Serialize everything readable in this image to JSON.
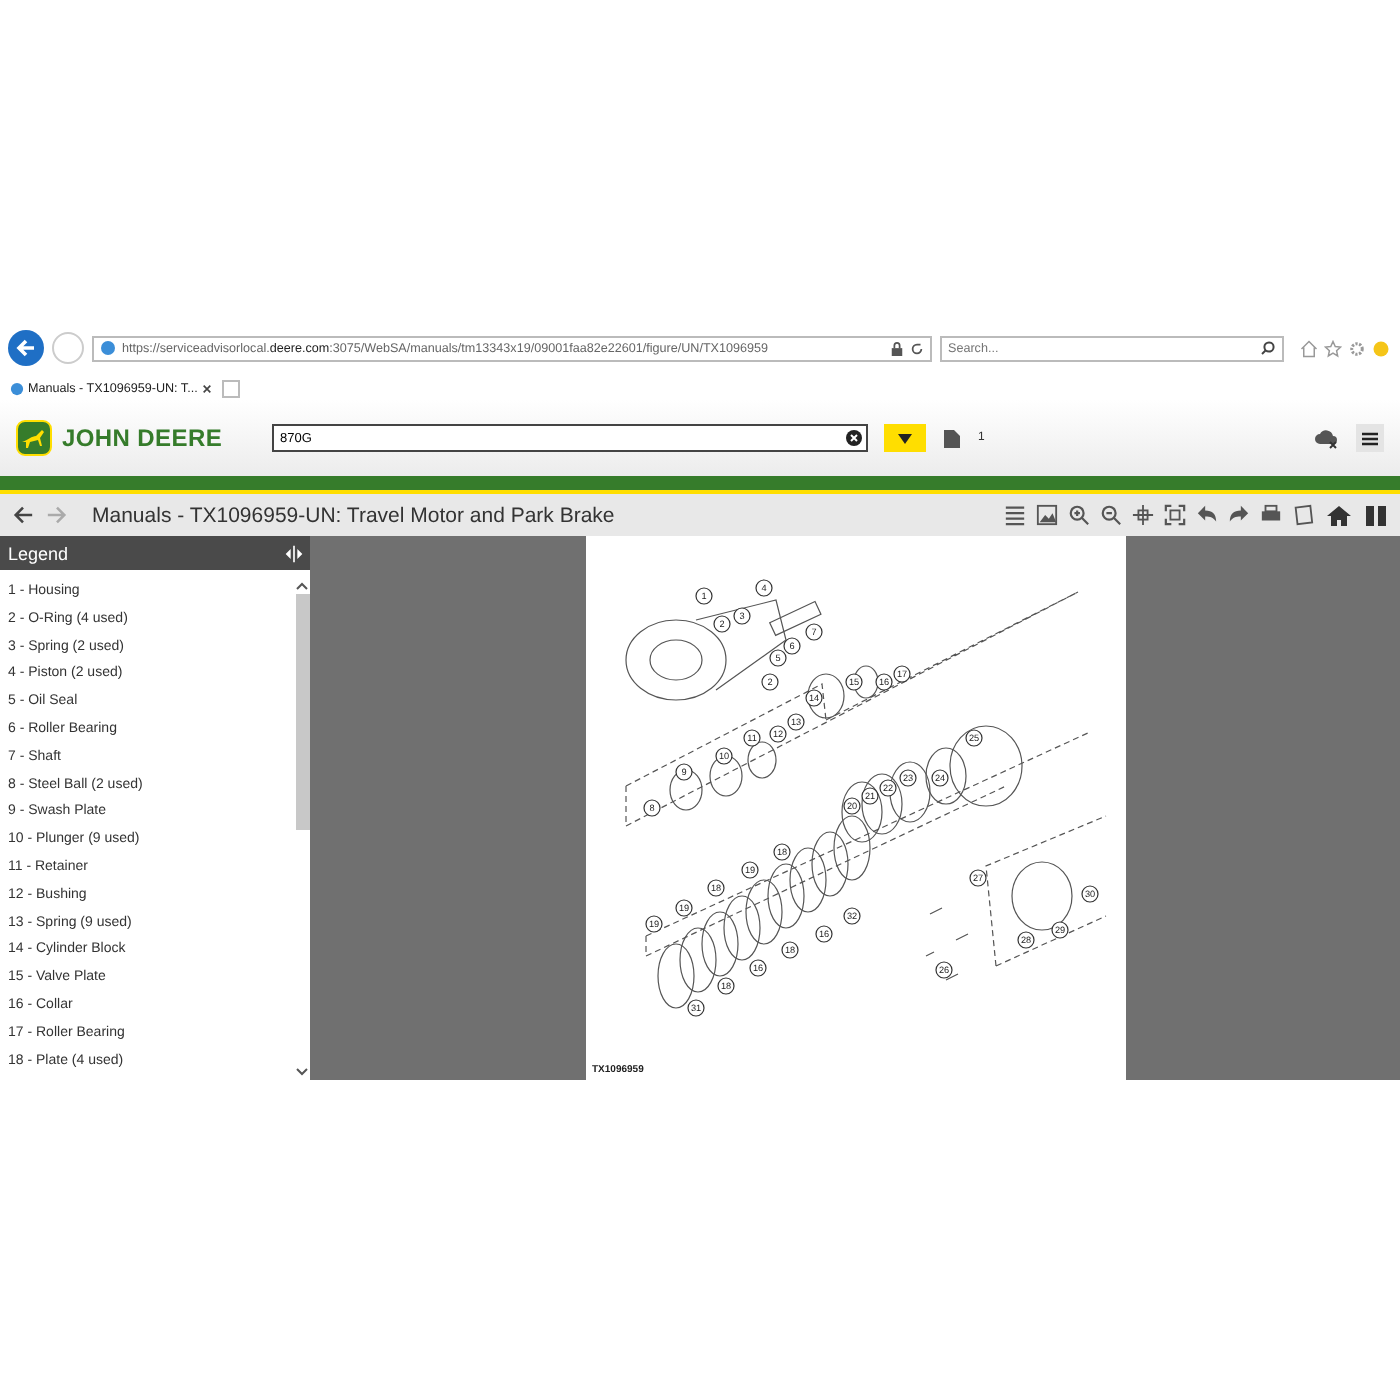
{
  "browser": {
    "address": "https://serviceadvisorlocal.**deere.com**:3075/WebSA/manuals/tm13343x19/09001faa82e22601/figure/UN/TX1096959",
    "search_placeholder": "Search...",
    "tab_title": "Manuals - TX1096959-UN: T..."
  },
  "header": {
    "brand": "JOHN DEERE",
    "search_value": "870G",
    "badge": "1"
  },
  "page_title": "Manuals - TX1096959-UN: Travel Motor and Park Brake",
  "legend": {
    "title": "Legend",
    "items": [
      "1 - Housing",
      "2 - O-Ring (4 used)",
      "3 - Spring (2 used)",
      "4 - Piston (2 used)",
      "5 - Oil Seal",
      "6 - Roller Bearing",
      "7 - Shaft",
      "8 - Steel Ball (2 used)",
      "9 - Swash Plate",
      "10 - Plunger (9 used)",
      "11 - Retainer",
      "12 - Bushing",
      "13 - Spring (9 used)",
      "14 - Cylinder Block",
      "15 - Valve Plate",
      "16 - Collar",
      "17 - Roller Bearing",
      "18 - Plate (4 used)"
    ]
  },
  "figure": {
    "callouts": [
      "1",
      "2",
      "3",
      "4",
      "5",
      "6",
      "7",
      "2",
      "15",
      "16",
      "17",
      "14",
      "13",
      "12",
      "11",
      "10",
      "9",
      "8",
      "25",
      "24",
      "23",
      "22",
      "21",
      "20",
      "18",
      "19",
      "18",
      "19",
      "19",
      "32",
      "16",
      "18",
      "16",
      "18",
      "31",
      "27",
      "30",
      "29",
      "28",
      "26"
    ],
    "caption": "TX1096959"
  }
}
